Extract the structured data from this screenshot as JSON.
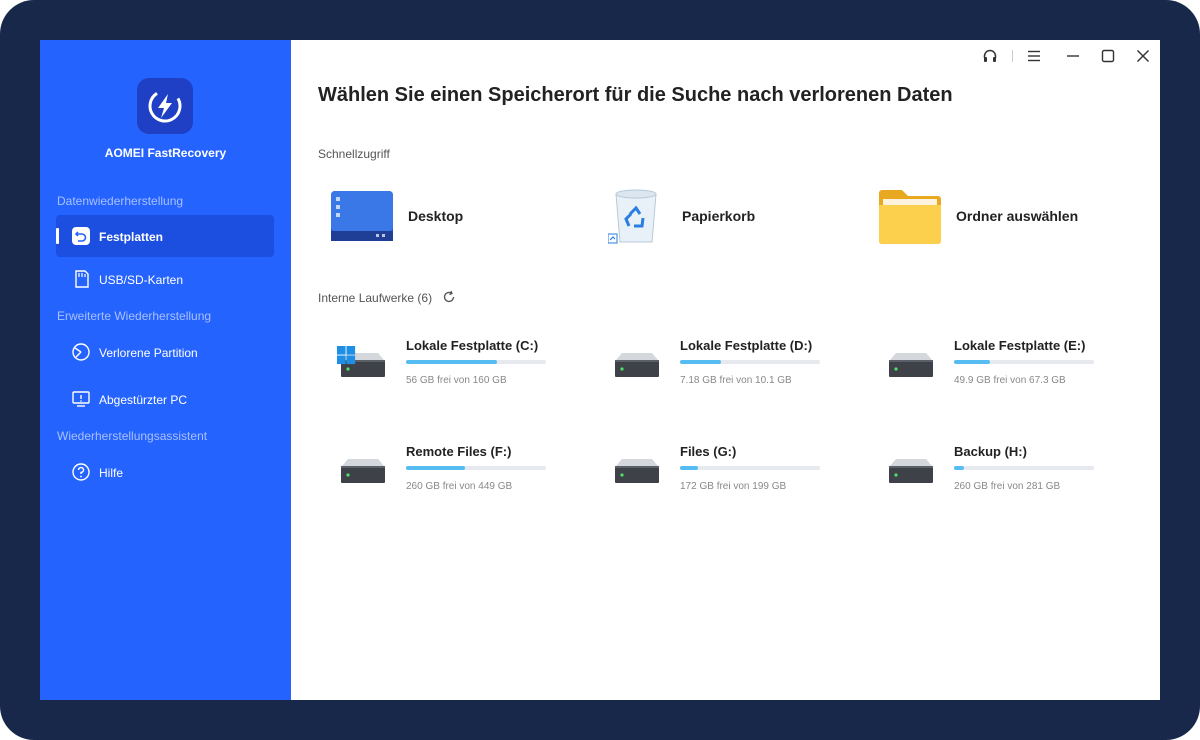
{
  "sidebar": {
    "brand": "AOMEI FastRecovery",
    "sections": [
      {
        "title": "Datenwiederherstellung"
      },
      {
        "title": "Erweiterte Wiederherstellung"
      },
      {
        "title": "Wiederherstellungsassistent"
      }
    ],
    "items": [
      {
        "label": "Festplatten",
        "icon": "restore-icon"
      },
      {
        "label": "USB/SD-Karten",
        "icon": "sd-card-icon"
      },
      {
        "label": "Verlorene Partition",
        "icon": "partition-icon"
      },
      {
        "label": "Abgestürzter PC",
        "icon": "crashed-pc-icon"
      },
      {
        "label": "Hilfe",
        "icon": "help-icon"
      }
    ]
  },
  "main": {
    "title": "Wählen Sie einen Speicherort für die Suche nach verlorenen Daten",
    "quick_access_label": "Schnellzugriff",
    "quick": [
      {
        "label": "Desktop",
        "icon": "desktop-icon"
      },
      {
        "label": "Papierkorb",
        "icon": "recycle-bin-icon"
      },
      {
        "label": "Ordner auswählen",
        "icon": "folder-icon"
      }
    ],
    "drives_label": "Interne Laufwerke (6)",
    "drives": [
      {
        "name": "Lokale Festplatte (C:)",
        "free": "56 GB frei von 160 GB",
        "used_fraction": 0.65,
        "system": true
      },
      {
        "name": "Lokale Festplatte (D:)",
        "free": "7.18 GB frei von 10.1 GB",
        "used_fraction": 0.29
      },
      {
        "name": "Lokale Festplatte (E:)",
        "free": "49.9 GB frei von 67.3 GB",
        "used_fraction": 0.26
      },
      {
        "name": "Remote Files (F:)",
        "free": "260 GB frei von 449 GB",
        "used_fraction": 0.42
      },
      {
        "name": "Files (G:)",
        "free": "172 GB frei von 199 GB",
        "used_fraction": 0.13
      },
      {
        "name": "Backup (H:)",
        "free": "260 GB frei von 281 GB",
        "used_fraction": 0.07
      }
    ]
  },
  "colors": {
    "sidebar": "#2563ff",
    "accent_bar": "#56bdf2",
    "frame": "#17284a"
  }
}
